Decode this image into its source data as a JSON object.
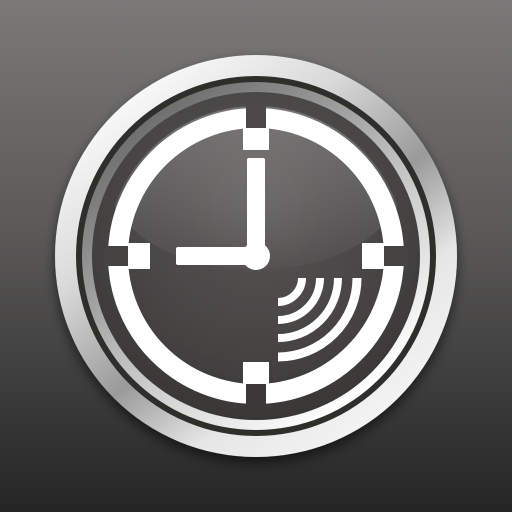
{
  "icon": {
    "kind": "app-icon",
    "glyph": "clock-with-signal-waves",
    "colors": {
      "background_top": "#7a7978",
      "background_bottom": "#262525",
      "face_dark": "#3e3c3b",
      "face_light": "#5a5857",
      "bezel_light": "#f4f4f4",
      "bezel_dark": "#8f8f8f",
      "glyph": "#ffffff"
    }
  }
}
